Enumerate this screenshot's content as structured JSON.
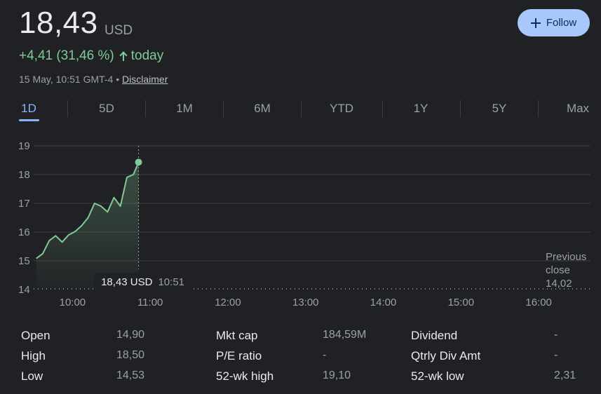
{
  "header": {
    "price": "18,43",
    "currency": "USD",
    "change_text": "+4,41 (31,46 %)",
    "change_suffix": "today",
    "timestamp": "15 May, 10:51 GMT-4 •",
    "disclaimer": "Disclaimer",
    "follow_label": "Follow",
    "accent_color": "#81c995"
  },
  "tabs": [
    "1D",
    "5D",
    "1M",
    "6M",
    "YTD",
    "1Y",
    "5Y",
    "Max"
  ],
  "active_tab": "1D",
  "chart_data": {
    "type": "area",
    "y_ticks": [
      "19",
      "18",
      "17",
      "16",
      "15",
      "14"
    ],
    "x_ticks": [
      "10:00",
      "11:00",
      "12:00",
      "13:00",
      "14:00",
      "15:00",
      "16:00"
    ],
    "ylim": [
      14,
      19
    ],
    "xlim": [
      "09:30",
      "16:40"
    ],
    "grid": true,
    "line_color": "#81c995",
    "series": [
      {
        "x": [
          "09:32",
          "09:37",
          "09:42",
          "09:47",
          "09:52",
          "09:57",
          "10:02",
          "10:07",
          "10:12",
          "10:17",
          "10:22",
          "10:27",
          "10:32",
          "10:37",
          "10:42",
          "10:47",
          "10:51"
        ],
        "values": [
          15.08,
          15.25,
          15.7,
          15.87,
          15.65,
          15.9,
          16.02,
          16.22,
          16.5,
          17.0,
          16.9,
          16.7,
          17.2,
          16.9,
          17.9,
          18.0,
          18.43
        ]
      }
    ],
    "previous_close": {
      "label": "Previous close",
      "value": "14,02"
    },
    "tooltip": {
      "price": "18,43 USD",
      "time": "10:51"
    }
  },
  "stats": [
    [
      {
        "label": "Open",
        "value": "14,90"
      },
      {
        "label": "High",
        "value": "18,50"
      },
      {
        "label": "Low",
        "value": "14,53"
      }
    ],
    [
      {
        "label": "Mkt cap",
        "value": "184,59M"
      },
      {
        "label": "P/E ratio",
        "value": "-"
      },
      {
        "label": "52-wk high",
        "value": "19,10"
      }
    ],
    [
      {
        "label": "Dividend",
        "value": "-"
      },
      {
        "label": "Qtrly Div Amt",
        "value": "-"
      },
      {
        "label": "52-wk low",
        "value": "2,31"
      }
    ]
  ]
}
